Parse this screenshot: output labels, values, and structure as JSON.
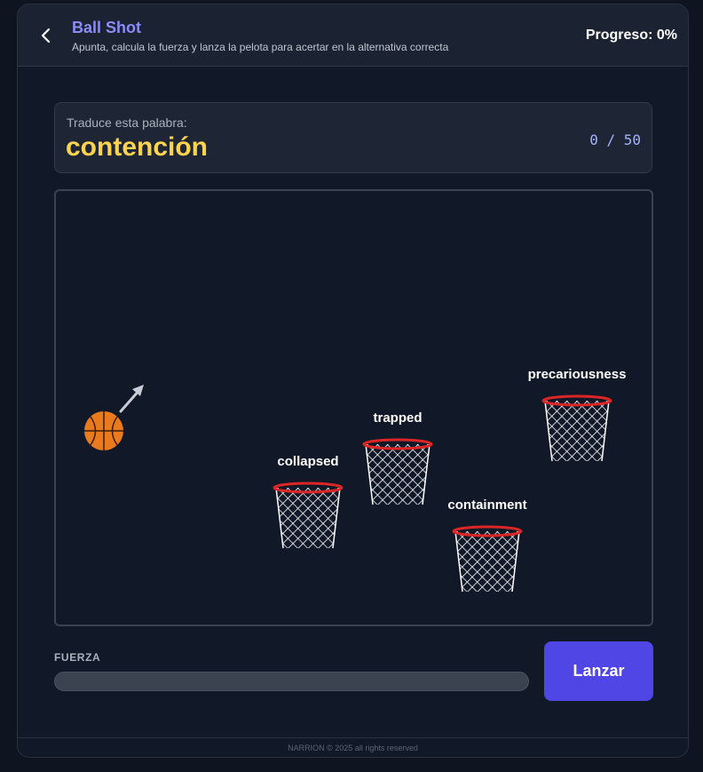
{
  "header": {
    "title": "Ball Shot",
    "subtitle": "Apunta, calcula la fuerza y lanza la pelota para acertar en la alternativa correcta",
    "progress": "Progreso: 0%"
  },
  "prompt": {
    "label": "Traduce esta palabra:",
    "word": "contención",
    "counter": "0 / 50"
  },
  "court": {
    "ball_icon": "basketball-icon",
    "aim_icon": "aim-arrow-icon",
    "baskets": [
      {
        "label": "collapsed"
      },
      {
        "label": "trapped"
      },
      {
        "label": "containment"
      },
      {
        "label": "precariousness"
      }
    ]
  },
  "controls": {
    "force_label": "FUERZA",
    "force_value": 0,
    "launch_label": "Lanzar"
  },
  "footer": {
    "text": "NARRION © 2025 all rights reserved"
  },
  "colors": {
    "accent": "#5046e5",
    "title": "#8b8cf8",
    "word": "#fcd34d",
    "rim": "#dc2626",
    "ball": "#ea7a1e"
  }
}
